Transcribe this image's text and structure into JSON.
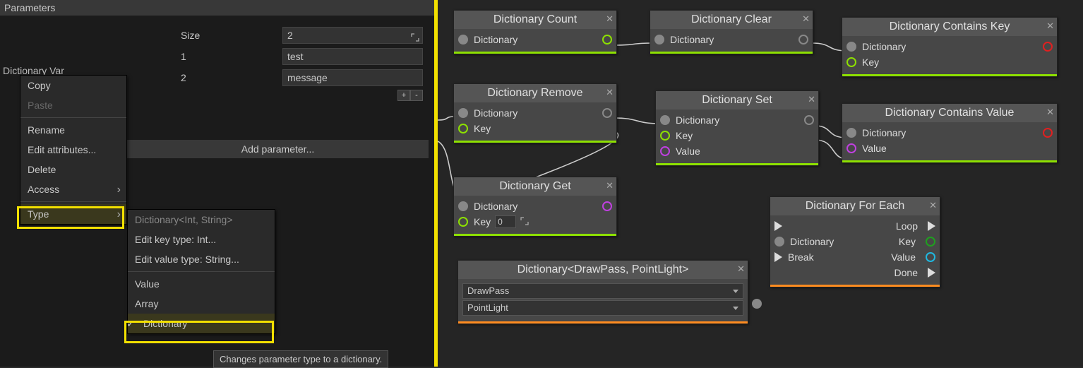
{
  "left": {
    "title": "Parameters",
    "var_name": "Dictionary Var",
    "size_label": "Size",
    "size_value": "2",
    "rows": [
      {
        "idx": "1",
        "val": "test"
      },
      {
        "idx": "2",
        "val": "message"
      }
    ],
    "add_param_label": "Add parameter...",
    "ctx1": {
      "copy": "Copy",
      "paste": "Paste",
      "rename": "Rename",
      "edit_attr": "Edit attributes...",
      "delete": "Delete",
      "access": "Access",
      "type": "Type"
    },
    "ctx2": {
      "header": "Dictionary<Int, String>",
      "edit_key": "Edit key type: Int...",
      "edit_val": "Edit value type: String...",
      "value": "Value",
      "array": "Array",
      "dictionary": "Dictionary"
    },
    "tooltip": "Changes parameter type to a dictionary."
  },
  "nodes": {
    "count": {
      "title": "Dictionary Count",
      "in_dict": "Dictionary",
      "footer": "green"
    },
    "clear": {
      "title": "Dictionary Clear",
      "in_dict": "Dictionary",
      "footer": "green"
    },
    "contains_key": {
      "title": "Dictionary Contains Key",
      "in_dict": "Dictionary",
      "in_key": "Key",
      "footer": "green"
    },
    "remove": {
      "title": "Dictionary Remove",
      "in_dict": "Dictionary",
      "in_key": "Key",
      "footer": "green"
    },
    "set": {
      "title": "Dictionary Set",
      "in_dict": "Dictionary",
      "in_key": "Key",
      "in_val": "Value",
      "footer": "green"
    },
    "contains_value": {
      "title": "Dictionary Contains Value",
      "in_dict": "Dictionary",
      "in_val": "Value",
      "footer": "green"
    },
    "get": {
      "title": "Dictionary Get",
      "in_dict": "Dictionary",
      "in_key": "Key",
      "key_val": "0",
      "footer": "green"
    },
    "typenode": {
      "title": "Dictionary<DrawPass, PointLight>",
      "type1": "DrawPass",
      "type2": "PointLight",
      "footer": "orange"
    },
    "foreach": {
      "title": "Dictionary For Each",
      "in_dict": "Dictionary",
      "in_break": "Break",
      "out_loop": "Loop",
      "out_key": "Key",
      "out_val": "Value",
      "out_done": "Done",
      "footer": "orange"
    }
  }
}
